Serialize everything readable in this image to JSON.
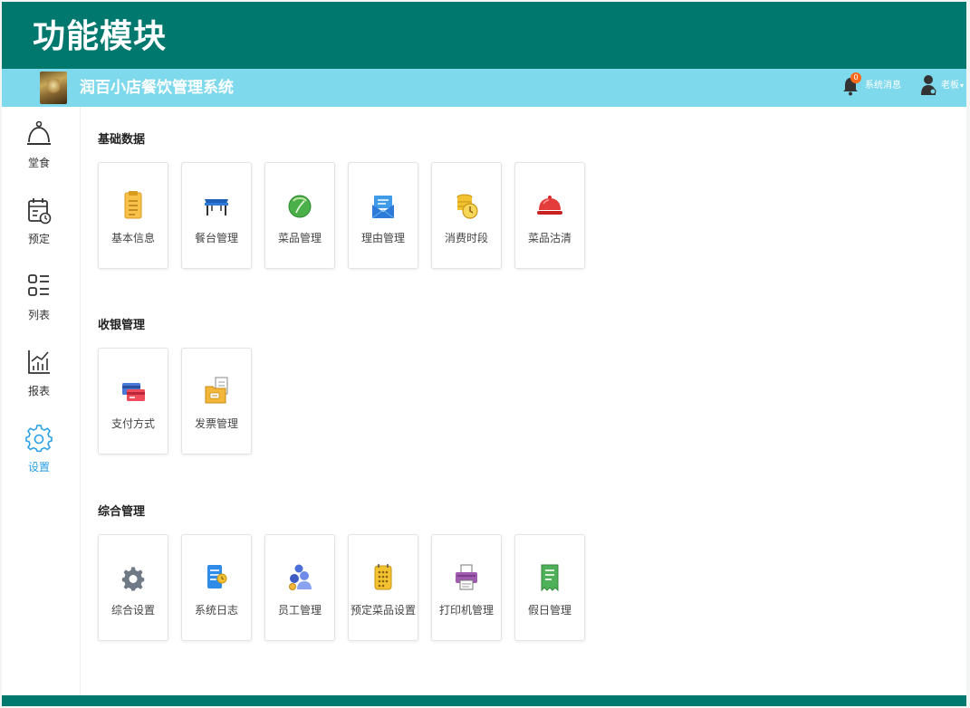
{
  "slide": {
    "title": "功能模块"
  },
  "topbar": {
    "system_title": "润百小店餐饮管理系统",
    "message_count": "0",
    "message_label": "系统消息",
    "user_name": "老板",
    "caret": "▾"
  },
  "sidebar": {
    "items": [
      {
        "label": "堂食",
        "icon": "service-bell-icon"
      },
      {
        "label": "预定",
        "icon": "calendar-clock-icon"
      },
      {
        "label": "列表",
        "icon": "list-icon"
      },
      {
        "label": "报表",
        "icon": "chart-icon"
      },
      {
        "label": "设置",
        "icon": "gear-icon",
        "active": true
      }
    ]
  },
  "sections": [
    {
      "title": "基础数据",
      "cards": [
        {
          "label": "基本信息",
          "icon": "clipboard-icon"
        },
        {
          "label": "餐台管理",
          "icon": "table-icon"
        },
        {
          "label": "菜品管理",
          "icon": "vegetable-icon"
        },
        {
          "label": "理由管理",
          "icon": "envelope-icon"
        },
        {
          "label": "消费时段",
          "icon": "coins-clock-icon"
        },
        {
          "label": "菜品沽清",
          "icon": "cloche-icon"
        }
      ]
    },
    {
      "title": "收银管理",
      "cards": [
        {
          "label": "支付方式",
          "icon": "credit-card-icon"
        },
        {
          "label": "发票管理",
          "icon": "invoice-folder-icon"
        }
      ]
    },
    {
      "title": "综合管理",
      "cards": [
        {
          "label": "综合设置",
          "icon": "settings-gear-icon"
        },
        {
          "label": "系统日志",
          "icon": "log-document-icon"
        },
        {
          "label": "员工管理",
          "icon": "staff-icon"
        },
        {
          "label": "预定菜品设置",
          "icon": "reservation-menu-icon"
        },
        {
          "label": "打印机管理",
          "icon": "printer-icon"
        },
        {
          "label": "假日管理",
          "icon": "receipt-icon"
        }
      ]
    }
  ],
  "colors": {
    "header": "#00786d",
    "topbar": "#7fd9ec",
    "active": "#2aa0e8",
    "badge": "#ff6a1a"
  }
}
